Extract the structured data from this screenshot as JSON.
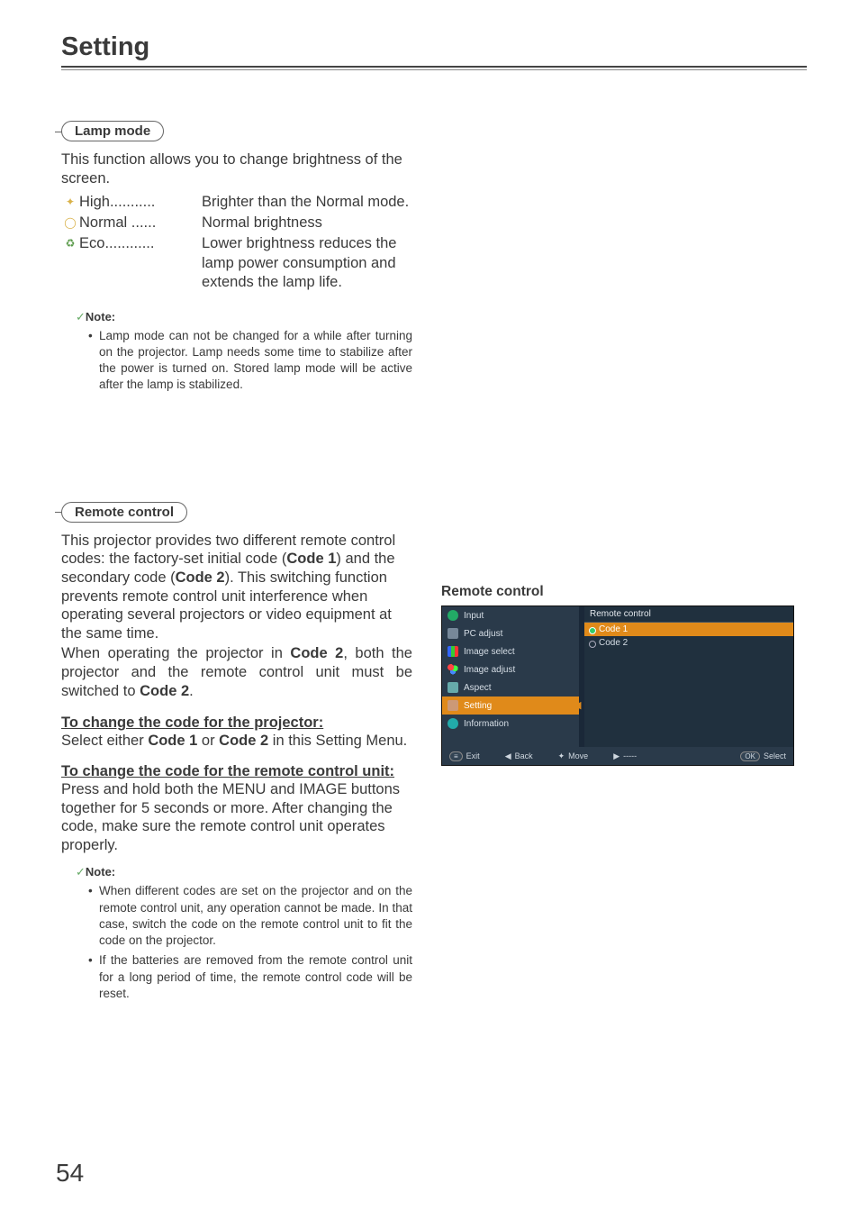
{
  "page": {
    "title": "Setting",
    "number": "54"
  },
  "sections": {
    "lamp": {
      "label": "Lamp mode",
      "intro": "This function allows you to change brightness of the screen.",
      "modes": [
        {
          "term": "High",
          "dots": "...........",
          "desc": "Brighter than the Normal mode."
        },
        {
          "term": "Normal",
          "dots": " ......",
          "desc": "Normal brightness"
        },
        {
          "term": "Eco",
          "dots": "............",
          "desc": "Lower brightness reduces the lamp power consumption and extends the lamp life."
        }
      ],
      "note_label": "Note:",
      "note": "Lamp mode can not be changed for a while after turning on the projector. Lamp needs some time to stabilize after the power is turned on. Stored lamp mode will be active after the lamp is stabilized."
    },
    "remote": {
      "label": "Remote control",
      "p1a": "This projector provides two different remote control codes: the factory-set initial code (",
      "p1b": "Code 1",
      "p1c": ") and the secondary code (",
      "p1d": "Code 2",
      "p1e": "). This switching function prevents remote control unit interference when operating several projectors or video equipment at the same time.",
      "p2a": "When operating the projector in ",
      "p2b": "Code 2",
      "p2c": ", both the projector and the remote control unit must be switched to ",
      "p2d": "Code 2",
      "p2e": ".",
      "h1": "To change the code for the projector:",
      "p3a": "Select either ",
      "p3b": "Code 1",
      "p3c": " or ",
      "p3d": "Code 2",
      "p3e": " in this Setting Menu.",
      "h2": "To change the code for the remote control unit:",
      "p4": "Press and hold both the MENU and IMAGE buttons together for 5 seconds or more.  After changing the code, make sure the remote control unit operates properly.",
      "note_label": "Note:",
      "notes": [
        "When different codes are set on the projector and on the remote control unit, any operation cannot be made. In that case, switch the code on the remote control unit to fit the code on the projector.",
        "If the batteries are removed from the remote control unit for a long period of time, the remote control code will be reset."
      ]
    }
  },
  "figure": {
    "title": "Remote control",
    "sidebar": [
      "Input",
      "PC adjust",
      "Image select",
      "Image adjust",
      "Aspect",
      "Setting",
      "Information"
    ],
    "panel_title": "Remote control",
    "options": [
      "Code 1",
      "Code 2"
    ],
    "footer": {
      "exit": "Exit",
      "back": "Back",
      "move": "Move",
      "dash": "-----",
      "select": "Select"
    }
  }
}
